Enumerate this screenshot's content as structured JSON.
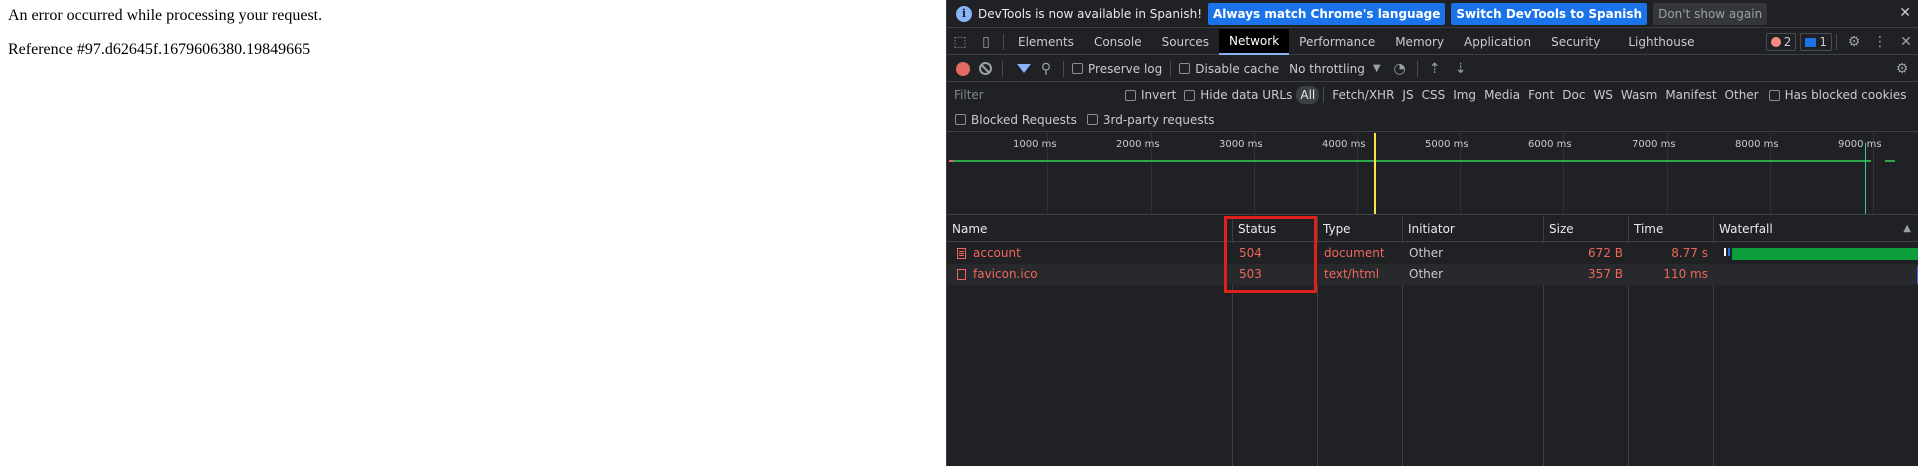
{
  "page": {
    "error_message": "An error occurred while processing your request.",
    "reference": "Reference #97.d62645f.1679606380.19849665"
  },
  "devtools": {
    "infobar": {
      "message": "DevTools is now available in Spanish!",
      "match_button": "Always match Chrome's language",
      "switch_button": "Switch DevTools to Spanish",
      "dismiss_button": "Don't show again"
    },
    "tabs": [
      {
        "label": "Elements"
      },
      {
        "label": "Console"
      },
      {
        "label": "Sources"
      },
      {
        "label": "Network",
        "active": true
      },
      {
        "label": "Performance"
      },
      {
        "label": "Memory"
      },
      {
        "label": "Application"
      },
      {
        "label": "Security"
      },
      {
        "label": "Lighthouse"
      }
    ],
    "error_count": "2",
    "message_count": "1",
    "toolbar": {
      "preserve_log": "Preserve log",
      "disable_cache": "Disable cache",
      "throttling": "No throttling"
    },
    "filter": {
      "placeholder": "Filter",
      "invert": "Invert",
      "hide_data_urls": "Hide data URLs",
      "types": [
        "All",
        "Fetch/XHR",
        "JS",
        "CSS",
        "Img",
        "Media",
        "Font",
        "Doc",
        "WS",
        "Wasm",
        "Manifest",
        "Other"
      ],
      "has_blocked_cookies": "Has blocked cookies",
      "blocked_requests": "Blocked Requests",
      "third_party": "3rd-party requests"
    },
    "timeline_ticks": [
      "1000 ms",
      "2000 ms",
      "3000 ms",
      "4000 ms",
      "5000 ms",
      "6000 ms",
      "7000 ms",
      "8000 ms",
      "9000 ms"
    ],
    "columns": {
      "name": "Name",
      "status": "Status",
      "type": "Type",
      "initiator": "Initiator",
      "size": "Size",
      "time": "Time",
      "waterfall": "Waterfall"
    },
    "requests": [
      {
        "name": "account",
        "status": "504",
        "type": "document",
        "initiator": "Other",
        "size": "672 B",
        "time": "8.77 s"
      },
      {
        "name": "favicon.ico",
        "status": "503",
        "type": "text/html",
        "initiator": "Other",
        "size": "357 B",
        "time": "110 ms"
      }
    ],
    "colors": {
      "error_text": "#ee675c",
      "highlight_box": "#e0211a",
      "accent": "#1a73e8"
    }
  }
}
